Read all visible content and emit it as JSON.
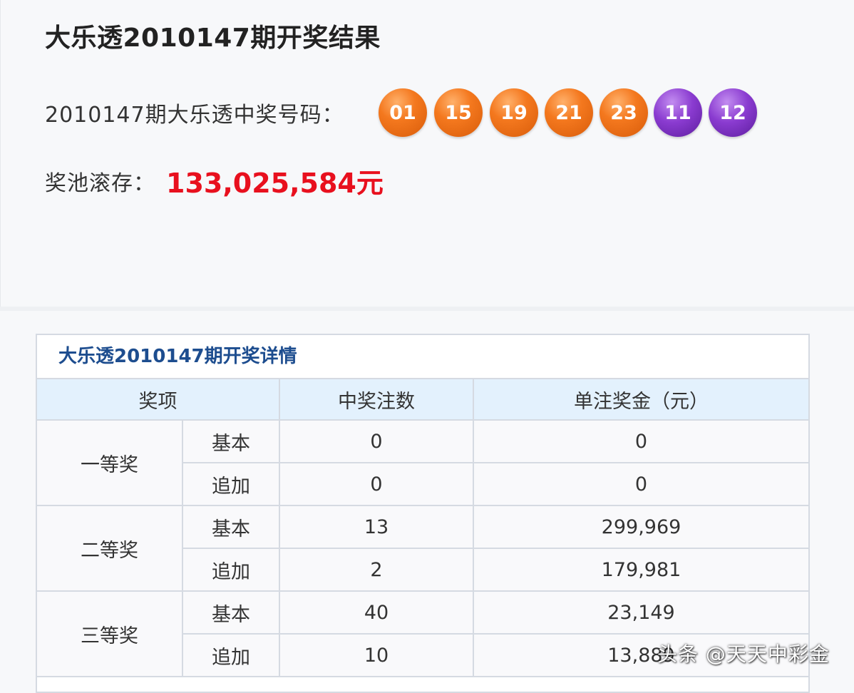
{
  "page": {
    "title": "大乐透2010147期开奖结果",
    "numbers_label": "2010147期大乐透中奖号码：",
    "front_numbers": [
      "01",
      "15",
      "19",
      "21",
      "23"
    ],
    "back_numbers": [
      "11",
      "12"
    ],
    "pool_label": "奖池滚存：",
    "pool_value": "133,025,584元"
  },
  "colors": {
    "front_ball": "#f4781e",
    "back_ball": "#8a3bd0",
    "pool_value": "#e8101e",
    "detail_title": "#1d4d8f",
    "table_header_bg": "#e3f1fd"
  },
  "details": {
    "title": "大乐透2010147期开奖详情",
    "headers": [
      "奖项",
      "中奖注数",
      "单注奖金（元）"
    ],
    "levels": [
      {
        "name": "一等奖",
        "rows": [
          {
            "type": "基本",
            "count": "0",
            "prize": "0"
          },
          {
            "type": "追加",
            "count": "0",
            "prize": "0"
          }
        ]
      },
      {
        "name": "二等奖",
        "rows": [
          {
            "type": "基本",
            "count": "13",
            "prize": "299,969"
          },
          {
            "type": "追加",
            "count": "2",
            "prize": "179,981"
          }
        ]
      },
      {
        "name": "三等奖",
        "rows": [
          {
            "type": "基本",
            "count": "40",
            "prize": "23,149"
          },
          {
            "type": "追加",
            "count": "10",
            "prize": "13,889"
          }
        ]
      }
    ]
  },
  "watermark": "头条 @天天中彩金"
}
